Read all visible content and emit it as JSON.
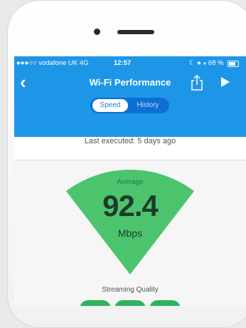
{
  "status_bar": {
    "carrier": "●●●○○ vodafone UK  4G",
    "time": "12:57",
    "right_indicators": "☾ ● ⁎ 68 %"
  },
  "nav": {
    "back_icon": "chevron-left-icon",
    "title": "Wi-Fi Performance",
    "share_icon": "share-icon",
    "play_icon": "play-icon"
  },
  "tabs": [
    {
      "label": "Speed",
      "selected": true
    },
    {
      "label": "History",
      "selected": false
    }
  ],
  "last_executed": "Last executed: 5 days ago",
  "gauge": {
    "label": "Average",
    "value": "92.4",
    "unit": "Mbps",
    "color": "#4cc46e"
  },
  "streaming": {
    "label": "Streaming Quality",
    "badge_color": "#2fb45c"
  },
  "colors": {
    "accent": "#1e96e8",
    "segment_bg": "#0d6fd2"
  }
}
